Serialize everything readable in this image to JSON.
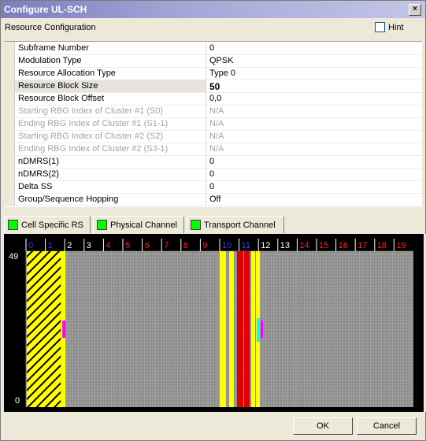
{
  "window": {
    "title": "Configure UL-SCH",
    "close_glyph": "×"
  },
  "section": {
    "title": "Resource Configuration",
    "hint_label": "Hint",
    "hint_checked": false
  },
  "params": [
    {
      "label": "Subframe Number",
      "value": "0",
      "state": "normal"
    },
    {
      "label": "Modulation Type",
      "value": "QPSK",
      "state": "normal"
    },
    {
      "label": "Resource Allocation Type",
      "value": "Type 0",
      "state": "normal"
    },
    {
      "label": "Resource Block Size",
      "value": "50",
      "state": "selected"
    },
    {
      "label": "Resource Block Offset",
      "value": "0,0",
      "state": "normal"
    },
    {
      "label": "Starting RBG Index of Cluster #1 (S0)",
      "value": "N/A",
      "state": "disabled"
    },
    {
      "label": "Ending RBG Index of Cluster #1 (S1-1)",
      "value": "N/A",
      "state": "disabled"
    },
    {
      "label": "Starting RBG Index of Cluster #2 (S2)",
      "value": "N/A",
      "state": "disabled"
    },
    {
      "label": "Ending RBG Index of Cluster #2 (S3-1)",
      "value": "N/A",
      "state": "disabled"
    },
    {
      "label": "nDMRS(1)",
      "value": "0",
      "state": "normal"
    },
    {
      "label": "nDMRS(2)",
      "value": "0",
      "state": "normal"
    },
    {
      "label": "Delta SS",
      "value": "0",
      "state": "normal"
    },
    {
      "label": "Group/Sequence Hopping",
      "value": "Off",
      "state": "normal"
    }
  ],
  "tabs": [
    {
      "label": "Cell Specific RS",
      "swatch": "#00ff00"
    },
    {
      "label": "Physical Channel",
      "swatch": "#00ff00"
    },
    {
      "label": "Transport Channel",
      "swatch": "#00ff00"
    }
  ],
  "rb_map": {
    "subframe_labels": [
      "0",
      "1",
      "2",
      "3",
      "4",
      "5",
      "6",
      "7",
      "8",
      "9",
      "10",
      "11",
      "12",
      "13",
      "14",
      "15",
      "16",
      "17",
      "18",
      "19"
    ],
    "y_top_label": "49",
    "y_bottom_label": "0",
    "colors": {
      "background": "#000000",
      "grid": "#b0b0b0",
      "label_blue": "#3a3aff",
      "label_red": "#ff2020",
      "label_white": "#ffffff",
      "yellow": "#ffff00",
      "hatch": "#000000",
      "red": "#e00000",
      "magenta": "#ff00ff",
      "cyan": "#00ffff",
      "green": "#00ff00"
    }
  },
  "buttons": {
    "ok": "OK",
    "cancel": "Cancel"
  }
}
